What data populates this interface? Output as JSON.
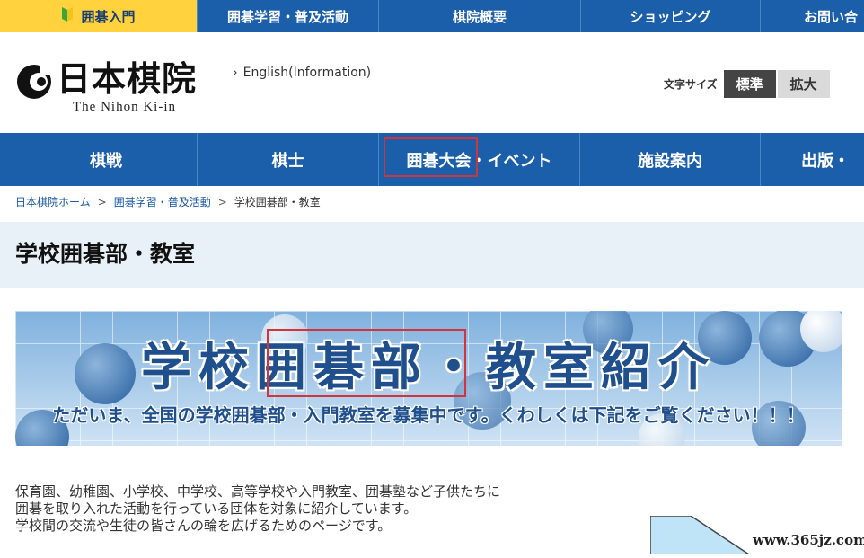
{
  "top_nav": {
    "items": [
      {
        "label": "囲碁入門",
        "active": true
      },
      {
        "label": "囲碁学習・普及活動",
        "active": false
      },
      {
        "label": "棋院概要",
        "active": false
      },
      {
        "label": "ショッピング",
        "active": false
      },
      {
        "label": "お問い合",
        "active": false
      }
    ]
  },
  "header": {
    "logo_text": "日本棋院",
    "logo_sub": "The Nihon Ki-in",
    "english_link": "English(Information)",
    "font_size_label": "文字サイズ",
    "font_size_standard": "標準",
    "font_size_large": "拡大"
  },
  "main_nav": {
    "items": [
      {
        "label": "棋戦"
      },
      {
        "label": "棋士"
      },
      {
        "label": "囲碁大会・イベント"
      },
      {
        "label": "施設案内"
      },
      {
        "label": "出版・"
      }
    ]
  },
  "breadcrumb": {
    "items": [
      "日本棋院ホーム",
      "囲碁学習・普及活動",
      "学校囲碁部・教室"
    ],
    "separator": ">"
  },
  "page": {
    "title": "学校囲碁部・教室"
  },
  "banner": {
    "title": "学校囲碁部・教室紹介",
    "subtitle": "ただいま、全国の学校囲碁部・入門教室を募集中です。くわしくは下記をご覧ください！！！"
  },
  "intro": {
    "line1": "保育園、幼稚園、小学校、中学校、高等学校や入門教室、囲碁塾など子供たちに",
    "line2": "囲碁を取り入れた活動を行っている団体を対象に紹介しています。",
    "line3": "学校間の交流や生徒の皆さんの輪を広げるためのページです。"
  },
  "watermark": "www.365jz.com",
  "colors": {
    "nav_blue": "#1b5faa",
    "active_yellow": "#ffd23e",
    "highlight_red": "#d3343c",
    "title_band": "#e9f1f8",
    "banner_text": "#1f4f8c"
  }
}
